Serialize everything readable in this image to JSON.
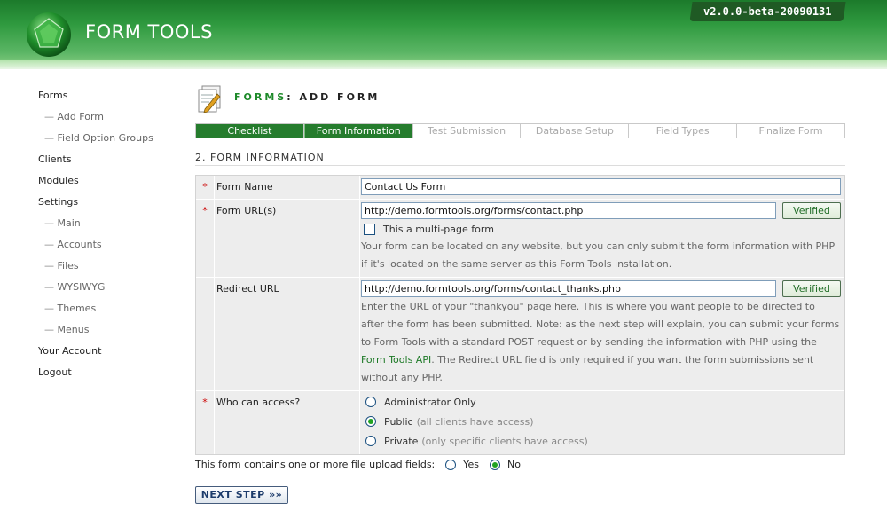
{
  "header": {
    "title": "FORM TOOLS",
    "version": "v2.0.0-beta-20090131"
  },
  "nav": {
    "items": [
      {
        "label": "Forms",
        "sub": false
      },
      {
        "label": "Add Form",
        "sub": true
      },
      {
        "label": "Field Option Groups",
        "sub": true
      },
      {
        "label": "Clients",
        "sub": false
      },
      {
        "label": "Modules",
        "sub": false
      },
      {
        "label": "Settings",
        "sub": false
      },
      {
        "label": "Main",
        "sub": true
      },
      {
        "label": "Accounts",
        "sub": true
      },
      {
        "label": "Files",
        "sub": true
      },
      {
        "label": "WYSIWYG",
        "sub": true
      },
      {
        "label": "Themes",
        "sub": true
      },
      {
        "label": "Menus",
        "sub": true
      },
      {
        "label": "Your Account",
        "sub": false
      },
      {
        "label": "Logout",
        "sub": false
      }
    ]
  },
  "page": {
    "heading_green": "FORMS",
    "heading_rest": ": ADD FORM",
    "section_title": "2. FORM INFORMATION"
  },
  "tabs": [
    {
      "label": "Checklist",
      "state": "done"
    },
    {
      "label": "Form Information",
      "state": "current"
    },
    {
      "label": "Test Submission",
      "state": "todo"
    },
    {
      "label": "Database Setup",
      "state": "todo"
    },
    {
      "label": "Field Types",
      "state": "todo"
    },
    {
      "label": "Finalize Form",
      "state": "todo"
    }
  ],
  "form": {
    "required_mark": "*",
    "form_name": {
      "label": "Form Name",
      "value": "Contact Us Form"
    },
    "form_url": {
      "label": "Form URL(s)",
      "value": "http://demo.formtools.org/forms/contact.php",
      "verify_label": "Verified",
      "multi_page_label": "This a multi-page form",
      "help": "Your form can be located on any website, but you can only submit the form information with PHP if it's located on the same server as this Form Tools installation."
    },
    "redirect_url": {
      "label": "Redirect URL",
      "value": "http://demo.formtools.org/forms/contact_thanks.php",
      "verify_label": "Verified",
      "help_before": "Enter the URL of your \"thankyou\" page here. This is where you want people to be directed to after the form has been submitted. Note: as the next step will explain, you can submit your forms to Form Tools with a standard POST request or by sending the information with PHP using the ",
      "help_link": "Form Tools API",
      "help_after": ". The Redirect URL field is only required if you want the form submissions sent without any PHP."
    },
    "access": {
      "label": "Who can access?",
      "options": [
        {
          "label": "Administrator Only",
          "note": "",
          "selected": false
        },
        {
          "label": "Public",
          "note": "(all clients have access)",
          "selected": true
        },
        {
          "label": "Private",
          "note": "(only specific clients have access)",
          "selected": false
        }
      ]
    }
  },
  "upload": {
    "question": "This form contains one or more file upload fields:",
    "yes_label": "Yes",
    "no_label": "No",
    "selected": "No"
  },
  "next_button": "NEXT STEP »»"
}
